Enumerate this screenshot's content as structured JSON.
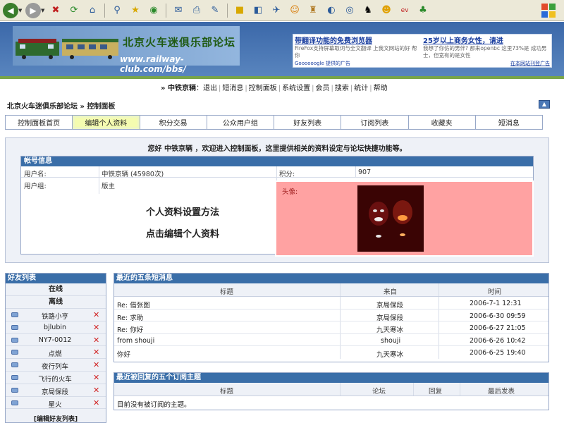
{
  "toolbar": {
    "icons": [
      "back-icon",
      "forward-icon",
      "stop-icon",
      "refresh-icon",
      "home-icon",
      "search-icon",
      "favorites-icon",
      "media-icon",
      "mail-icon",
      "print-icon",
      "edit-icon",
      "notes-icon",
      "messenger-icon",
      "translate-icon",
      "smiley-icon",
      "bag-icon",
      "rss-icon",
      "globe-icon",
      "qq-icon",
      "face-icon",
      "sina-icon",
      "msn-icon"
    ]
  },
  "banner": {
    "site_title": "北京火车迷俱乐部论坛",
    "site_url": "www.railway-club.com/bbs/",
    "ads": [
      {
        "headline": "带翻译功能的免费浏览器",
        "text": "FireFox支持屏幕取词与全文翻译 上我文网站的好 帮你"
      },
      {
        "headline": "25岁以上商务女性，请进",
        "text": "我想了你仿的男伴? 那来openbc 这里73%是 成功男士，但宽有的是女性"
      }
    ],
    "ad_provider": "Goooooogle 提供的广告",
    "ad_link": "在本网站刊登广告"
  },
  "topnav": {
    "user": "» 中铁京辆",
    "items": [
      "退出",
      "短消息",
      "控制面板",
      "系统设置",
      "会员",
      "搜索",
      "统计",
      "帮助"
    ]
  },
  "breadcrumb": {
    "site": "北京火车迷俱乐部论坛",
    "page": "» 控制面板"
  },
  "tabs": [
    "控制面板首页",
    "编辑个人资料",
    "积分交易",
    "公众用户组",
    "好友列表",
    "订阅列表",
    "收藏夹",
    "短消息"
  ],
  "panel": {
    "welcome": "您好  中铁京辆 ，欢迎进入控制面板，这里提供相关的资料设定与论坛快捷功能等。",
    "account": {
      "title": "帐号信息",
      "username_label": "用户名:",
      "username_value": "中铁京辆 (45980次)",
      "credits_label": "积分:",
      "credits_value": "907",
      "group_label": "用户组:",
      "group_value": "版主",
      "avatar_label": "头像:"
    },
    "overlay": {
      "line1": "个人资料设置方法",
      "line2": "点击编辑个人资料"
    }
  },
  "friends": {
    "title": "好友列表",
    "online": "在线",
    "offline": "离线",
    "items": [
      "铁路小亨",
      "bjlubin",
      "NY7-0012",
      "点燃",
      "夜行列车",
      "飞行的火车",
      "京局保段",
      "星火"
    ],
    "footer": "[编辑好友列表]"
  },
  "messages": {
    "title": "最近的五条短消息",
    "headers": [
      "标题",
      "来自",
      "时间"
    ],
    "rows": [
      {
        "subject": "Re: 借张图",
        "from": "京局保段",
        "time": "2006-7-1 12:31"
      },
      {
        "subject": "Re: 求助",
        "from": "京局保段",
        "time": "2006-6-30 09:59"
      },
      {
        "subject": "Re: 你好",
        "from": "九天寒冰",
        "time": "2006-6-27 21:05"
      },
      {
        "subject": "from shouji",
        "from": "shouji",
        "time": "2006-6-26 10:42"
      },
      {
        "subject": "你好",
        "from": "九天寒冰",
        "time": "2006-6-25 19:40"
      }
    ]
  },
  "subscriptions": {
    "title": "最近被回复的五个订阅主题",
    "headers": [
      "标题",
      "论坛",
      "回复",
      "最后发表"
    ],
    "empty": "目前没有被订阅的主题。"
  }
}
